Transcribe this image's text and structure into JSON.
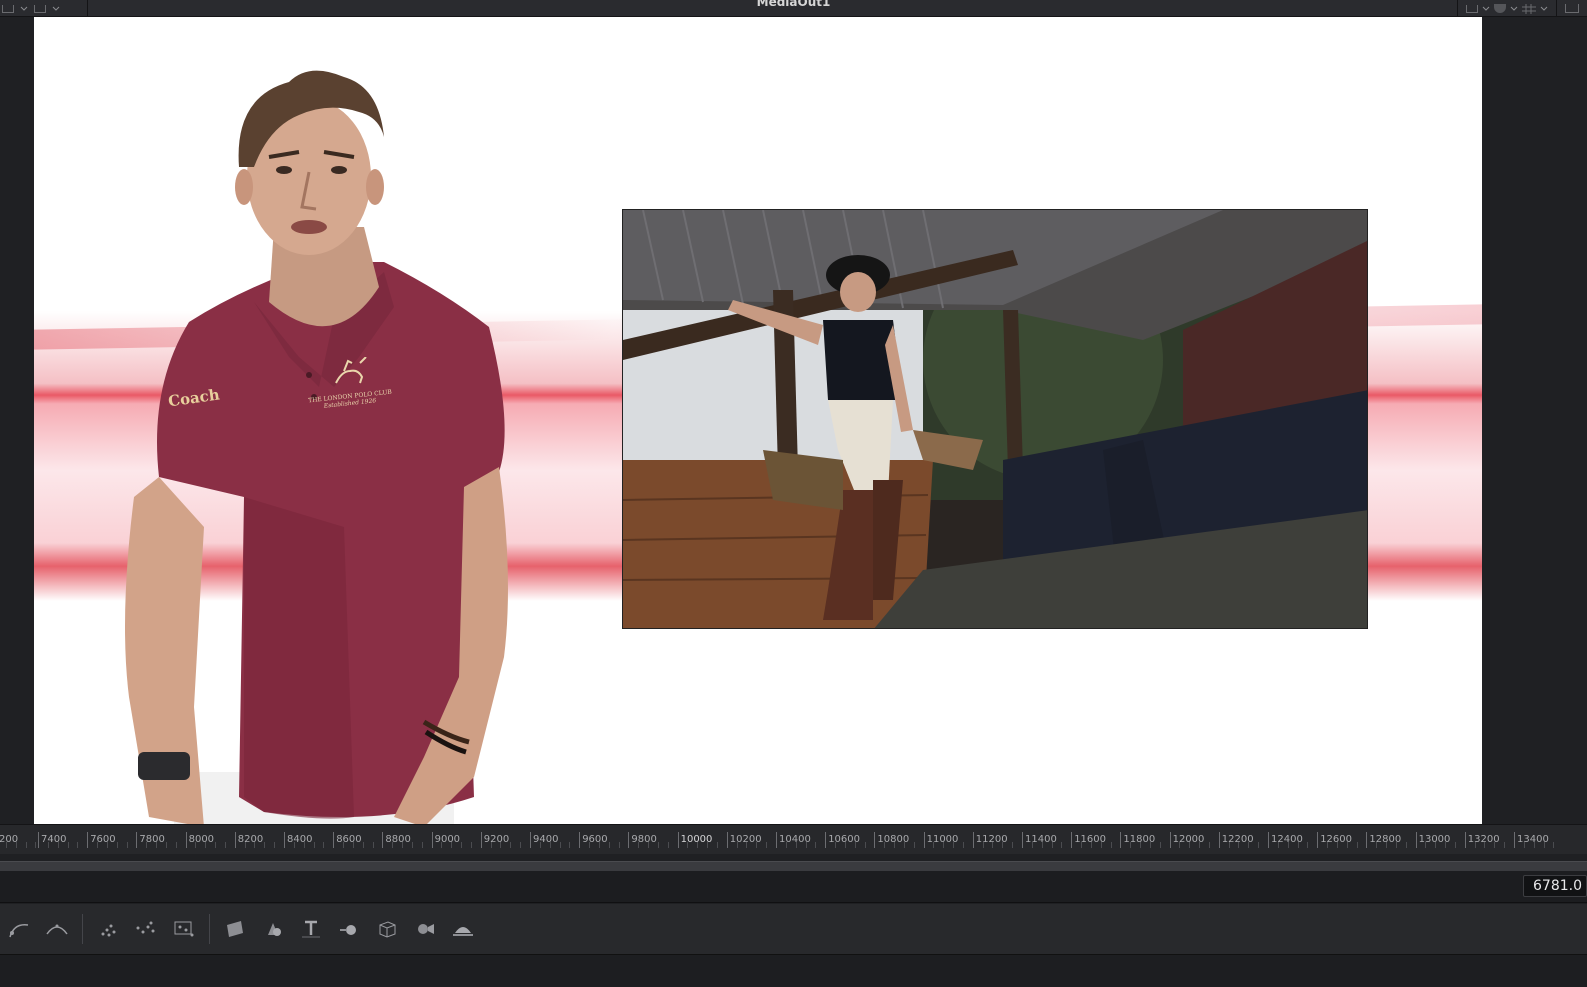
{
  "viewer": {
    "title": "MediaOut1"
  },
  "person": {
    "shirt_text_left": "Coach",
    "logo_text_1": "THE LONDON POLO CLUB",
    "logo_text_2": "Established 1926"
  },
  "ruler": {
    "labels": [
      "200",
      "7400",
      "7600",
      "7800",
      "8000",
      "8200",
      "8400",
      "8600",
      "8800",
      "9000",
      "9200",
      "9400",
      "9600",
      "9800",
      "10000",
      "10200",
      "10400",
      "10600",
      "10800",
      "11000",
      "11200",
      "11400",
      "11600",
      "11800",
      "12000",
      "12200",
      "12400",
      "12600",
      "12800",
      "13000",
      "13200",
      "13400"
    ],
    "highlight_label": "10000"
  },
  "time": {
    "current": "6781.0"
  },
  "toolbar": {
    "tools": [
      "bspline-icon",
      "bezier-icon",
      "particle-emitter-icon",
      "particle-render-icon",
      "particle-pmerge-icon",
      "image-plane-3d-icon",
      "shape-3d-icon",
      "text-3d-icon",
      "merge-3d-icon",
      "renderer-3d-icon",
      "camera-3d-icon",
      "spotlight-icon"
    ]
  },
  "colors": {
    "panel": "#1f2023",
    "accent_red": "#e0303c",
    "shirt": "#8a2f45"
  }
}
